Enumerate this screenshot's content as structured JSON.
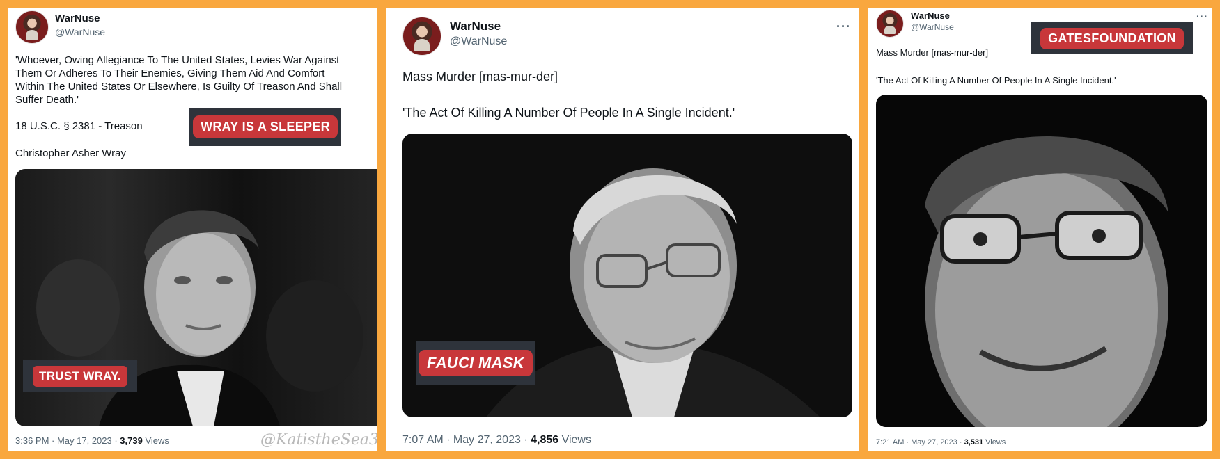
{
  "tweets": [
    {
      "name": "WarNuse",
      "handle": "@WarNuse",
      "body": "'Whoever, Owing Allegiance To The United States, Levies War Against\nThem Or Adheres To Their Enemies, Giving Them Aid And Comfort\nWithin The United States Or Elsewhere, Is Guilty Of Treason And Shall\nSuffer Death.'",
      "cite": "18 U.S.C. § 2381 - Treason",
      "person": "Christopher Asher Wray",
      "overlay_top": "WRAY IS A SLEEPER",
      "overlay_bottom": "TRUST WRAY.",
      "time": "3:36 PM · May 17, 2023 · ",
      "views": "3,739",
      "views_label": " Views",
      "watermark": "@KatistheSea3"
    },
    {
      "name": "WarNuse",
      "handle": "@WarNuse",
      "more": "···",
      "line1": "Mass Murder [mas-mur-der]",
      "line2": "'The Act Of Killing A Number Of People In A Single Incident.'",
      "overlay": "FAUCI MASK",
      "time": "7:07 AM · May 27, 2023 · ",
      "views": "4,856",
      "views_label": " Views"
    },
    {
      "name": "WarNuse",
      "handle": "@WarNuse",
      "more": "···",
      "overlay": "GATESFOUNDATION",
      "line1": "Mass Murder [mas-mur-der]",
      "line2": "'The Act Of Killing A Number Of People In A Single Incident.'",
      "time": "7:21 AM · May 27, 2023 · ",
      "views": "3,531",
      "views_label": " Views"
    }
  ]
}
